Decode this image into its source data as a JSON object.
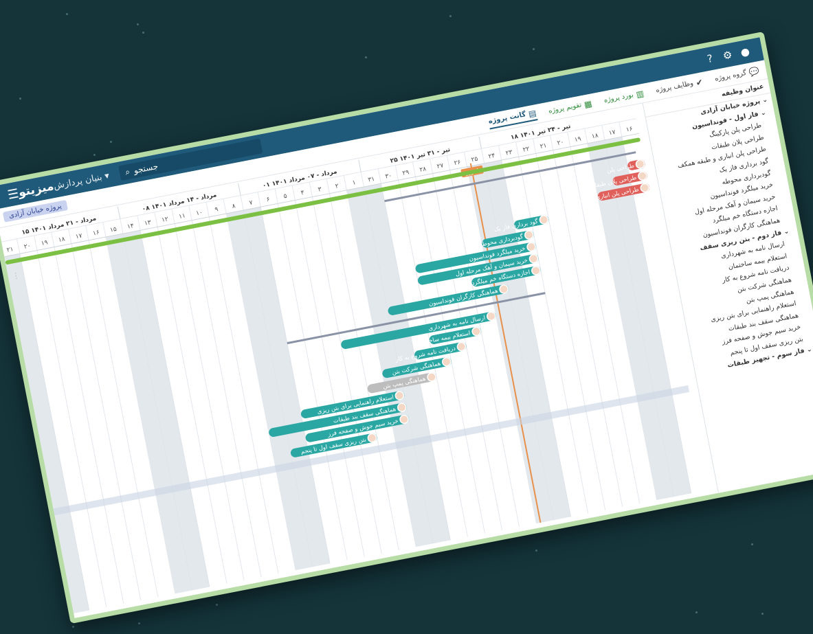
{
  "topbar": {
    "brand": "میزیتو",
    "project": "بنیان پردازش",
    "search_placeholder": "جستجو",
    "menu_icon": "hamburger-icon",
    "search_icon": "search-icon",
    "help_icon": "help-icon",
    "settings_icon": "gear-icon"
  },
  "nav": {
    "items": [
      {
        "label": "گروه پروژه",
        "icon": "chat-icon"
      },
      {
        "label": "وظایف پروژه",
        "icon": "check-icon"
      },
      {
        "label": "بورد پروژه",
        "icon": "board-icon"
      },
      {
        "label": "تقویم پروژه",
        "icon": "calendar-icon"
      },
      {
        "label": "گانت پروژه",
        "icon": "gantt-icon"
      }
    ],
    "project_chip": "پروژه خیابان آزادی"
  },
  "tree": {
    "header": "عنوان وظیفه",
    "rows": [
      {
        "label": "پروژه خیابان آزادی",
        "level": 0
      },
      {
        "label": "فاز اول - فونداسیون",
        "level": 1
      },
      {
        "label": "طراحی پلن پارکینگ",
        "level": 2
      },
      {
        "label": "طراحی پلان طبقات",
        "level": 2
      },
      {
        "label": "طراحی پلن انباری و طبقه همکف",
        "level": 2
      },
      {
        "label": "گود برداری فاز یک",
        "level": 2
      },
      {
        "label": "گودبرداری محوطه",
        "level": 2
      },
      {
        "label": "خرید میلگرد فونداسیون",
        "level": 2
      },
      {
        "label": "خرید سیمان و آهک مرحله اول",
        "level": 2
      },
      {
        "label": "اجازه دستگاه خم میلگرد",
        "level": 2
      },
      {
        "label": "هماهنگی کارگران فونداسیون",
        "level": 2
      },
      {
        "label": "فاز دوم - بتن ریزی سقف",
        "level": 1
      },
      {
        "label": "ارسال نامه به شهرداری",
        "level": 2
      },
      {
        "label": "استعلام بیمه ساختمان",
        "level": 2
      },
      {
        "label": "دریافت نامه شروع به کار",
        "level": 2
      },
      {
        "label": "هماهنگی شرکت بتن",
        "level": 2
      },
      {
        "label": "هماهنگی پمپ بتن",
        "level": 2
      },
      {
        "label": "استعلام راهنمایی برای بتن ریزی",
        "level": 2
      },
      {
        "label": "هماهنگی سقف بند طبقات",
        "level": 2
      },
      {
        "label": "خرید سیم جوش و صفحه فرز",
        "level": 2
      },
      {
        "label": "بتن ریزی سقف اول تا پنجم",
        "level": 2
      },
      {
        "label": "فاز سوم - تجهیز طبقات",
        "level": 1
      }
    ]
  },
  "timeline": {
    "weeks": [
      {
        "label": "۱۸ تیر - ۲۴ تیر ۱۴۰۱",
        "days": [
          "۱۸",
          "۱۹",
          "۲۰",
          "۲۱",
          "۲۲",
          "۲۳",
          "۲۴"
        ]
      },
      {
        "label": "۲۵ تیر - ۳۱ تیر ۱۴۰۱",
        "days": [
          "۲۵",
          "۲۶",
          "۲۷",
          "۲۸",
          "۲۹",
          "۳۰",
          "۳۱"
        ]
      },
      {
        "label": "۰۱ مرداد - ۰۷ مرداد ۱۴۰۱",
        "days": [
          "۱",
          "۲",
          "۳",
          "۴",
          "۵",
          "۶",
          "۷"
        ]
      },
      {
        "label": "۰۸ مرداد - ۱۴ مرداد ۱۴۰۱",
        "days": [
          "۸",
          "۹",
          "۱۰",
          "۱۱",
          "۱۲",
          "۱۳",
          "۱۴"
        ]
      },
      {
        "label": "۱۵ مرداد - ۲۱ مرداد ۱۴۰۱",
        "days": [
          "۱۵",
          "۱۶",
          "۱۷",
          "۱۸",
          "۱۹",
          "۲۰",
          "۲۱"
        ]
      }
    ],
    "leading_days": [
      "۱۶",
      "۱۷"
    ],
    "today_label": "امروز",
    "colors": {
      "teal": "#2aa7a3",
      "red": "#e0605c",
      "gray": "#bdbdbd",
      "green": "#7bc043",
      "summary": "#8a93a6",
      "today": "#e8904a",
      "weekend": "#d7dee6"
    }
  },
  "tasks": [
    {
      "label": "طراحی پلن",
      "color": "red",
      "start": 0,
      "dur": 1
    },
    {
      "label": "طراحی پلان طبقات",
      "color": "red",
      "start": 0,
      "dur": 2
    },
    {
      "label": "طراحی پلن انباری و طبقه همکف",
      "color": "red",
      "start": 0,
      "dur": 3
    },
    {
      "label": "گود برداری فاز یک",
      "color": "teal",
      "start": 6,
      "dur": 2
    },
    {
      "label": "گودبرداری محوطه",
      "color": "teal",
      "start": 7,
      "dur": 3
    },
    {
      "label": "خرید میلگرد فونداسیون",
      "color": "teal",
      "start": 7,
      "dur": 7
    },
    {
      "label": "خرید سیمان و آهک مرحله اول",
      "color": "teal",
      "start": 7,
      "dur": 7
    },
    {
      "label": "اجازه دستگاه خم میلگرد",
      "color": "teal",
      "start": 7,
      "dur": 4
    },
    {
      "label": "هماهنگی کارگران فونداسیون",
      "color": "teal",
      "start": 9,
      "dur": 7
    },
    {
      "label": "ارسال نامه به شهرداری",
      "color": "teal",
      "start": 10,
      "dur": 9
    },
    {
      "label": "استعلام بیمه ساختمان",
      "color": "teal",
      "start": 11,
      "dur": 3
    },
    {
      "label": "دریافت نامه شروع به کار",
      "color": "teal",
      "start": 12,
      "dur": 3
    },
    {
      "label": "هماهنگی شرکت بتن",
      "color": "teal",
      "start": 13,
      "dur": 4
    },
    {
      "label": "هماهنگی پمپ بتن",
      "color": "gray",
      "start": 14,
      "dur": 4
    },
    {
      "label": "استعلام راهنمایی برای بتن ریزی",
      "color": "teal",
      "start": 16,
      "dur": 6
    },
    {
      "label": "هماهنگی سقف بند طبقات",
      "color": "teal",
      "start": 16,
      "dur": 8
    },
    {
      "label": "خرید سیم جوش و صفحه فرز",
      "color": "teal",
      "start": 16,
      "dur": 6
    },
    {
      "label": "بتن ریزی سقف اول تا پنجم",
      "color": "teal",
      "start": 18,
      "dur": 5
    }
  ]
}
